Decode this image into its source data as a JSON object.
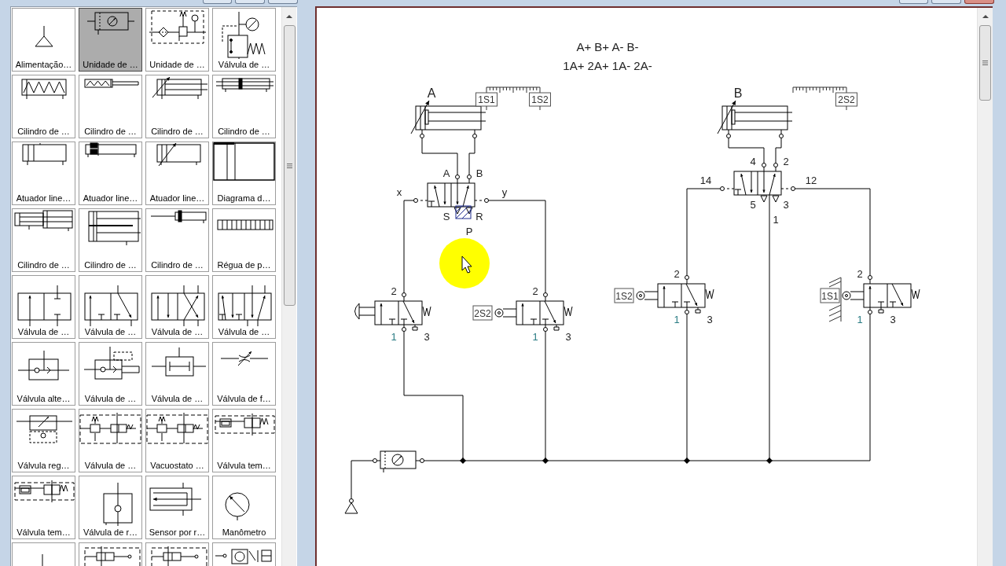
{
  "library": {
    "items": [
      {
        "label": "Alimentação…",
        "kind": "supply",
        "selected": false
      },
      {
        "label": "Unidade de …",
        "kind": "service-unit",
        "selected": true
      },
      {
        "label": "Unidade de …",
        "kind": "frl-unit",
        "selected": false
      },
      {
        "label": "Válvula de …",
        "kind": "pressure-valve",
        "selected": false
      },
      {
        "label": "Cilindro de …",
        "kind": "spring-cylinder",
        "selected": false
      },
      {
        "label": "Cilindro de …",
        "kind": "spring-rod-cylinder",
        "selected": false
      },
      {
        "label": "Cilindro de …",
        "kind": "cushion-cylinder",
        "selected": false
      },
      {
        "label": "Cilindro de …",
        "kind": "double-rod-cylinder",
        "selected": false
      },
      {
        "label": "Atuador line…",
        "kind": "linear-actuator",
        "selected": false
      },
      {
        "label": "Atuador line…",
        "kind": "magnetic-actuator",
        "selected": false
      },
      {
        "label": "Atuador line…",
        "kind": "cushion-actuator",
        "selected": false
      },
      {
        "label": "Diagrama d…",
        "kind": "chart-frame",
        "selected": false
      },
      {
        "label": "Cilindro de …",
        "kind": "tandem-cylinder",
        "selected": false
      },
      {
        "label": "Cilindro de …",
        "kind": "multi-cylinder",
        "selected": false
      },
      {
        "label": "Cilindro de …",
        "kind": "rodless-cylinder",
        "selected": false
      },
      {
        "label": "Régua de p…",
        "kind": "ruler",
        "selected": false
      },
      {
        "label": "Válvula de …",
        "kind": "valve-2-2",
        "selected": false
      },
      {
        "label": "Válvula de …",
        "kind": "valve-3-2",
        "selected": false
      },
      {
        "label": "Válvula de …",
        "kind": "valve-4-2",
        "selected": false
      },
      {
        "label": "Válvula de …",
        "kind": "valve-5-2",
        "selected": false
      },
      {
        "label": "Válvula alte…",
        "kind": "shuttle-valve",
        "selected": false
      },
      {
        "label": "Válvula de …",
        "kind": "quick-exhaust",
        "selected": false
      },
      {
        "label": "Válvula de …",
        "kind": "and-valve",
        "selected": false
      },
      {
        "label": "Válvula de f…",
        "kind": "flow-valve",
        "selected": false
      },
      {
        "label": "Válvula reg…",
        "kind": "regulator",
        "selected": false
      },
      {
        "label": "Válvula de …",
        "kind": "switch-unit",
        "selected": false
      },
      {
        "label": "Vacuostato …",
        "kind": "switch-unit",
        "selected": false
      },
      {
        "label": "Válvula tem…",
        "kind": "timer-valve",
        "selected": false
      },
      {
        "label": "Válvula tem…",
        "kind": "timer-valve",
        "selected": false
      },
      {
        "label": "Válvula de r…",
        "kind": "check-block",
        "selected": false
      },
      {
        "label": "Sensor por r…",
        "kind": "reflex-sensor",
        "selected": false
      },
      {
        "label": "Manômetro",
        "kind": "gauge",
        "selected": false
      },
      {
        "kind": "stem",
        "selected": false
      },
      {
        "kind": "solenoid-unit",
        "selected": false
      },
      {
        "kind": "solenoid-unit",
        "selected": false
      },
      {
        "kind": "counter",
        "selected": false
      }
    ]
  },
  "diagram": {
    "sequence": [
      "A+ B+ A- B-",
      "1A+ 2A+ 1A- 2A-"
    ],
    "cylinders": [
      {
        "label": "A",
        "sensors": [
          {
            "tag": "1S1",
            "kind": "retracted"
          },
          {
            "tag": "1S2",
            "kind": "extended"
          }
        ]
      },
      {
        "label": "B",
        "sensors": [
          {
            "tag": "2S2",
            "kind": "extended"
          }
        ]
      }
    ],
    "main_valves": [
      {
        "selected": true,
        "port_labels": [
          "A",
          "B",
          "x",
          "y",
          "S",
          "R",
          "P"
        ]
      },
      {
        "selected": false,
        "port_labels": [
          "4",
          "2",
          "14",
          "12",
          "5",
          "3",
          "1"
        ]
      }
    ],
    "signal_valves": [
      {
        "kind": "push-button",
        "actuated": false,
        "port_labels": [
          "2",
          "1",
          "3"
        ]
      },
      {
        "kind": "roller",
        "tag": "2S2",
        "actuated": false,
        "port_labels": [
          "2",
          "1",
          "3"
        ]
      },
      {
        "kind": "roller",
        "tag": "1S2",
        "actuated": false,
        "port_labels": [
          "2",
          "1",
          "3"
        ]
      },
      {
        "kind": "roller",
        "tag": "1S1",
        "actuated": true,
        "port_labels": [
          "2",
          "1",
          "3"
        ]
      }
    ]
  }
}
